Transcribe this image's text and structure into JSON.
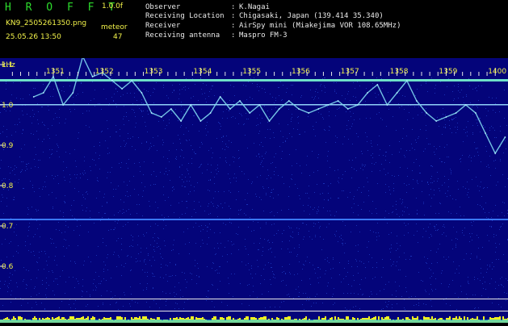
{
  "header": {
    "logo": "H R O F F T",
    "version": "1.0.0f",
    "filename": "KN9_2505261350.png",
    "datetime": "25.05.26 13:50",
    "meteor_label": "meteor",
    "meteor_count": "47"
  },
  "info": {
    "observer_label": "Observer",
    "observer_value": "K.Nagai",
    "location_label": "Receiving Location",
    "location_value": "Chigasaki, Japan (139.414 35.340)",
    "receiver_label": "Receiver",
    "receiver_value": "AirSpy mini (Miakejima VOR 108.65MHz)",
    "antenna_label": "Receiving antenna",
    "antenna_value": "Maspro FM-3",
    "separator": ":"
  },
  "spectrogram": {
    "y_unit": "kHz",
    "time_ticks": [
      "1351",
      "1352",
      "1353",
      "1354",
      "1355",
      "1356",
      "1357",
      "1358",
      "1359",
      "1400"
    ],
    "freq_ticks": [
      "1.1",
      "1.0",
      "0.9",
      "0.8",
      "0.7",
      "0.6"
    ],
    "colors": {
      "background": "#04047a",
      "noise": "#1f3fc8",
      "signal": "#7fd8f0",
      "tick_text": "#f2f24a",
      "grid_white": "#e8e8e8",
      "noise_floor": "#f0f020"
    }
  },
  "chart_data": {
    "type": "line",
    "title": "",
    "xlabel": "",
    "ylabel": "kHz",
    "x_ticks": [
      "1351",
      "1352",
      "1353",
      "1354",
      "1355",
      "1356",
      "1357",
      "1358",
      "1359",
      "1400"
    ],
    "ylim": [
      0.58,
      1.18
    ],
    "series": [
      {
        "x": [
          1350.6,
          1350.8,
          1351.0,
          1351.2,
          1351.4,
          1351.6,
          1351.8,
          1352.0,
          1352.2,
          1352.4,
          1352.6,
          1352.8,
          1353.0,
          1353.2,
          1353.4,
          1353.6,
          1353.8,
          1354.0,
          1354.2,
          1354.4,
          1354.6,
          1354.8,
          1355.0,
          1355.2,
          1355.4,
          1355.6,
          1355.8,
          1356.0,
          1356.2,
          1356.4,
          1356.6,
          1356.8,
          1357.0,
          1357.2,
          1357.4,
          1357.6,
          1357.8,
          1358.0,
          1358.2,
          1358.4,
          1358.6,
          1358.8,
          1359.0,
          1359.2,
          1359.4,
          1359.6,
          1359.8,
          1400.0,
          1400.2
        ],
        "y": [
          1.02,
          1.03,
          1.07,
          1.0,
          1.03,
          1.12,
          1.07,
          1.08,
          1.06,
          1.04,
          1.06,
          1.03,
          0.98,
          0.97,
          0.99,
          0.96,
          1.0,
          0.96,
          0.98,
          1.02,
          0.99,
          1.01,
          0.98,
          1.0,
          0.96,
          0.99,
          1.01,
          0.99,
          0.98,
          0.99,
          1.0,
          1.01,
          0.99,
          1.0,
          1.03,
          1.05,
          1.0,
          1.03,
          1.06,
          1.01,
          0.98,
          0.96,
          0.97,
          0.98,
          1.0,
          0.98,
          0.93,
          0.88,
          0.92
        ]
      }
    ]
  }
}
